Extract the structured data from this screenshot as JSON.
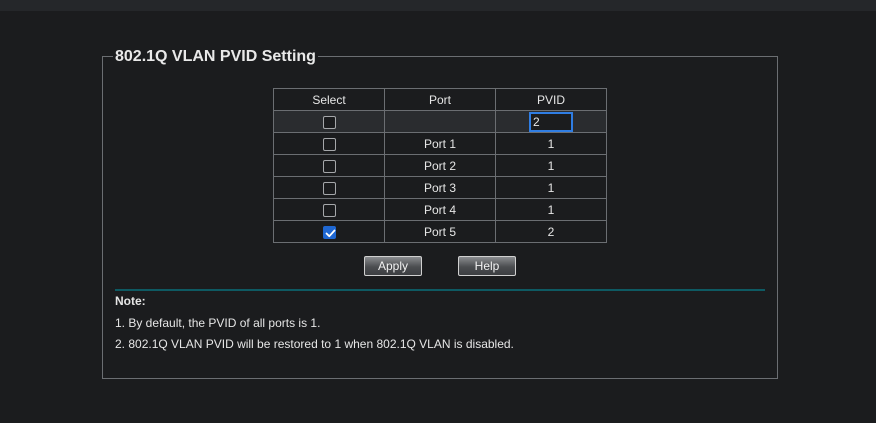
{
  "section": {
    "title": "802.1Q VLAN PVID Setting"
  },
  "table": {
    "headers": [
      "Select",
      "Port",
      "PVID"
    ],
    "edit_row": {
      "checked": false,
      "port": "",
      "pvid_value": "2"
    },
    "rows": [
      {
        "port": "Port 1",
        "pvid": "1",
        "checked": false
      },
      {
        "port": "Port 2",
        "pvid": "1",
        "checked": false
      },
      {
        "port": "Port 3",
        "pvid": "1",
        "checked": false
      },
      {
        "port": "Port 4",
        "pvid": "1",
        "checked": false
      },
      {
        "port": "Port 5",
        "pvid": "2",
        "checked": true
      }
    ]
  },
  "buttons": {
    "apply": "Apply",
    "help": "Help"
  },
  "note": {
    "title": "Note:",
    "lines": [
      "1. By default, the PVID of all ports is 1.",
      "2. 802.1Q VLAN PVID will be restored to 1 when 802.1Q VLAN is disabled."
    ]
  },
  "colors": {
    "checked_accent": "#1f67d2",
    "input_focus": "#2f7de3",
    "separator": "#0e5a63"
  },
  "icons": {
    "check": "checkmark-icon"
  }
}
